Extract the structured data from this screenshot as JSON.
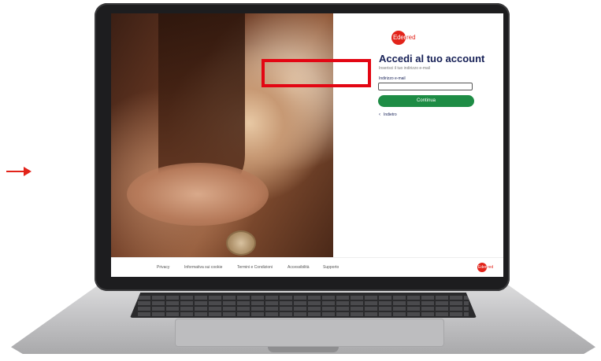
{
  "brand": {
    "name": "Edenred",
    "color": "#e2231a"
  },
  "login": {
    "title": "Accedi al tuo account",
    "subtitle": "Inserisci il tuo indirizzo e-mail",
    "email_label": "Indirizzo e-mail",
    "email_value": "",
    "continue_label": "Continua",
    "back_label": "Indietro"
  },
  "footer": {
    "links": [
      "Privacy",
      "Informativa sui cookie",
      "Termini e Condizioni",
      "Accessibilità",
      "Supporto"
    ]
  },
  "annotation": {
    "highlight_color": "#e30613",
    "arrow_color": "#e2231a"
  }
}
